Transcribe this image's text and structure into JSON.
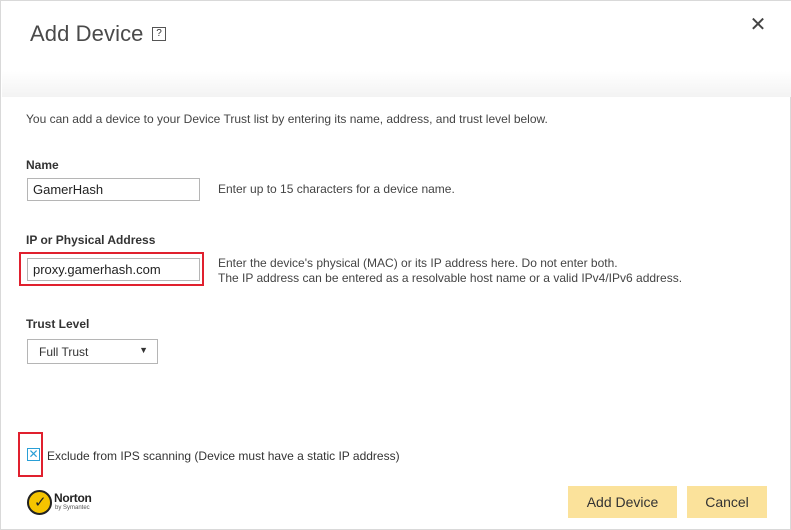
{
  "dialog": {
    "title": "Add Device",
    "help_glyph": "?",
    "close_glyph": "✕"
  },
  "intro": "You can add a device to your Device Trust list by entering its name, address, and trust level below.",
  "name_field": {
    "label": "Name",
    "value": "GamerHash",
    "hint": "Enter up to 15 characters for a device name."
  },
  "address_field": {
    "label": "IP or Physical Address",
    "value": "proxy.gamerhash.com",
    "hint_line1": "Enter the device's physical (MAC) or its IP address here. Do not enter both.",
    "hint_line2": "The IP address can be entered as a resolvable host name or a valid IPv4/IPv6 address."
  },
  "trust_level": {
    "label": "Trust Level",
    "selected": "Full Trust",
    "caret": "▼"
  },
  "exclude_ips": {
    "checked": true,
    "check_glyph": "✕",
    "label": "Exclude from IPS scanning (Device must have a static IP address)"
  },
  "brand": {
    "name": "Norton",
    "sub": "by Symantec",
    "tick": "✓"
  },
  "buttons": {
    "add": "Add Device",
    "cancel": "Cancel"
  },
  "colors": {
    "button_bg": "#fbe29b",
    "highlight": "#e0202e",
    "checkbox_accent": "#2a9fd6",
    "brand_yellow": "#f5c400"
  }
}
